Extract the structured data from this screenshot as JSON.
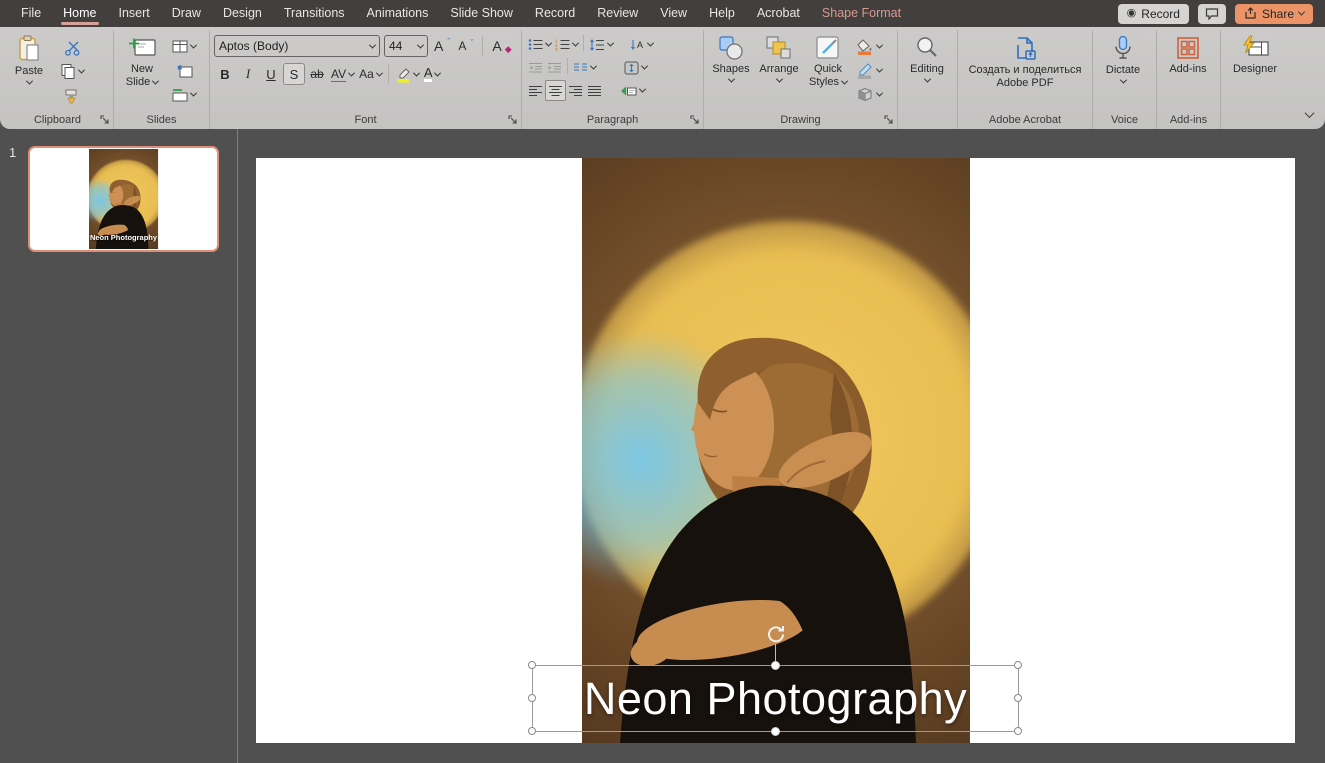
{
  "menubar": {
    "tabs": [
      "File",
      "Home",
      "Insert",
      "Draw",
      "Design",
      "Transitions",
      "Animations",
      "Slide Show",
      "Record",
      "Review",
      "View",
      "Help",
      "Acrobat",
      "Shape Format"
    ],
    "record": "Record",
    "share": "Share"
  },
  "ribbon": {
    "clipboard": {
      "label": "Clipboard",
      "paste": "Paste"
    },
    "slides": {
      "label": "Slides",
      "new1": "New",
      "new2": "Slide"
    },
    "font": {
      "label": "Font",
      "name": "Aptos (Body)",
      "size": "44",
      "bold": "B",
      "italic": "I",
      "underline": "U",
      "shadow": "S",
      "strike": "ab",
      "spacing": "AV",
      "case": "Aa",
      "color": "A"
    },
    "paragraph": {
      "label": "Paragraph"
    },
    "drawing": {
      "label": "Drawing",
      "shapes": "Shapes",
      "arrange": "Arrange",
      "quick1": "Quick",
      "quick2": "Styles"
    },
    "editing": {
      "label": "Editing"
    },
    "acrobat": {
      "label": "Adobe Acrobat",
      "line1": "Создать и поделиться",
      "line2": "Adobe PDF"
    },
    "voice": {
      "label": "Voice",
      "dictate": "Dictate"
    },
    "addins": {
      "label": "Add-ins",
      "button": "Add-ins"
    },
    "designer": {
      "label": "Designer"
    }
  },
  "thumbnails": {
    "slide_number": "1"
  },
  "slide": {
    "title": "Neon Photography"
  },
  "colors": {
    "accent_share": "#ec9467",
    "tab_underline": "#d8a096",
    "contextual_tab": "#d89a8c",
    "selection_border": "#df8e7a",
    "neon_yellow": "#e8bd52",
    "neon_blue": "#74c7ee"
  }
}
